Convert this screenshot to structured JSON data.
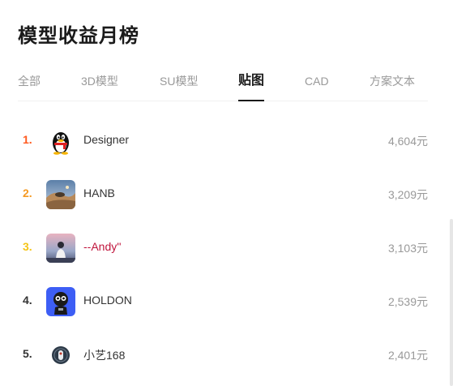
{
  "page": {
    "title": "模型收益月榜"
  },
  "tabs": [
    {
      "label": "全部"
    },
    {
      "label": "3D模型"
    },
    {
      "label": "SU模型"
    },
    {
      "label": "贴图"
    },
    {
      "label": "CAD"
    },
    {
      "label": "方案文本"
    }
  ],
  "active_tab": "贴图",
  "ranking": [
    {
      "rank": "1.",
      "name": "Designer",
      "amount": "4,604元",
      "rank_color": "#ff5a1f",
      "name_color": "#333333",
      "avatar": "qq-penguin-icon"
    },
    {
      "rank": "2.",
      "name": "HANB",
      "amount": "3,209元",
      "rank_color": "#f59a23",
      "name_color": "#333333",
      "avatar": "landscape-photo-avatar"
    },
    {
      "rank": "3.",
      "name": "--Andy''",
      "amount": "3,103元",
      "rank_color": "#f5c518",
      "name_color": "#c0143c",
      "avatar": "person-photo-avatar"
    },
    {
      "rank": "4.",
      "name": "HOLDON",
      "amount": "2,539元",
      "rank_color": "#333333",
      "name_color": "#333333",
      "avatar": "robot-avatar"
    },
    {
      "rank": "5.",
      "name": "小艺168",
      "amount": "2,401元",
      "rank_color": "#333333",
      "name_color": "#333333",
      "avatar": "round-logo-avatar"
    }
  ]
}
